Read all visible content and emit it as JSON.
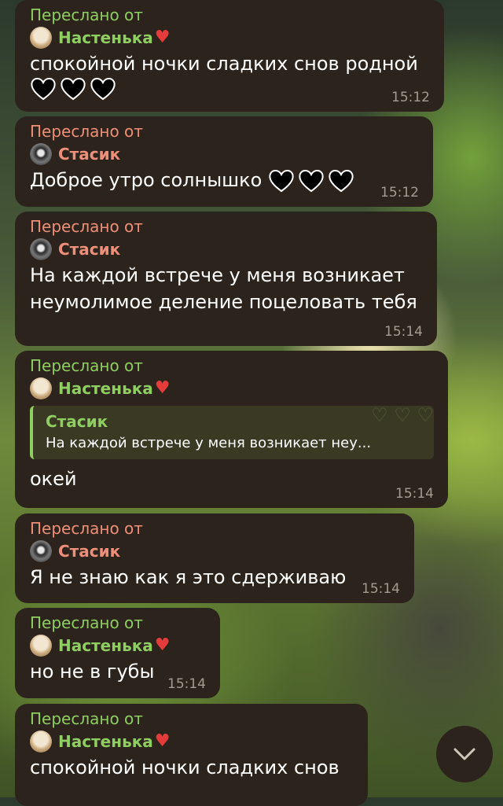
{
  "messages": [
    {
      "forwarded_label": "Переслано от",
      "sender": "Настенька",
      "text": "спокойной ночки сладких снов родной",
      "time": "15:12"
    },
    {
      "forwarded_label": "Переслано от",
      "sender": "Стасик",
      "text": "Доброе утро солнышко",
      "time": "15:12"
    },
    {
      "forwarded_label": "Переслано от",
      "sender": "Стасик",
      "text": "На каждой встрече у меня возникает неумолимое деление поцеловать тебя",
      "time": "15:14"
    },
    {
      "forwarded_label": "Переслано от",
      "sender": "Настенька",
      "quote_sender": "Стасик",
      "quote_text": "На каждой встрече у меня возникает неу...",
      "text": "окей",
      "time": "15:14"
    },
    {
      "forwarded_label": "Переслано от",
      "sender": "Стасик",
      "text": "Я не знаю как я это сдерживаю",
      "time": "15:14"
    },
    {
      "forwarded_label": "Переслано от",
      "sender": "Настенька",
      "text": "но не в губы",
      "time": "15:14"
    },
    {
      "forwarded_label": "Переслано от",
      "sender": "Настенька",
      "text": "спокойной ночки сладких снов"
    }
  ],
  "icons": {
    "sender_heart": "red-heart-icon",
    "message_hearts": "black-heart-icon",
    "scroll": "chevron-down-icon"
  },
  "colors": {
    "bubble": "#2b231c",
    "name_green": "#8fce60",
    "name_pink": "#ee8f7a"
  }
}
